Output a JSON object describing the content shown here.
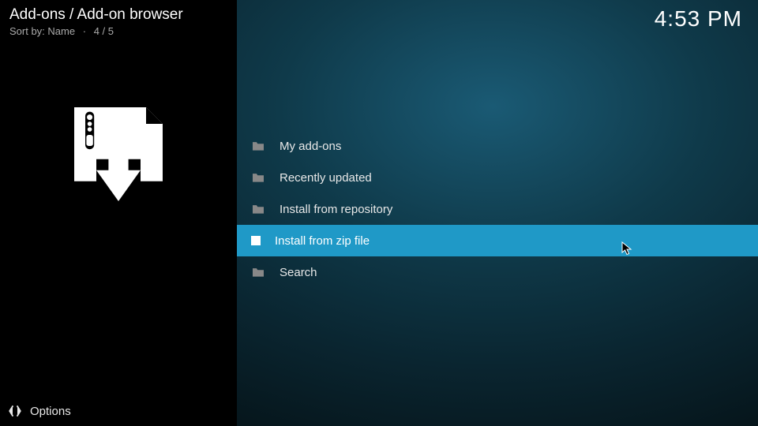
{
  "header": {
    "breadcrumb": "Add-ons / Add-on browser",
    "sort_label": "Sort by:",
    "sort_value": "Name",
    "position": "4 / 5"
  },
  "clock": "4:53 PM",
  "list": {
    "items": [
      {
        "label": "My add-ons",
        "icon": "folder"
      },
      {
        "label": "Recently updated",
        "icon": "folder"
      },
      {
        "label": "Install from repository",
        "icon": "folder"
      },
      {
        "label": "Install from zip file",
        "icon": "zip",
        "selected": true
      },
      {
        "label": "Search",
        "icon": "folder"
      }
    ]
  },
  "footer": {
    "options": "Options"
  }
}
